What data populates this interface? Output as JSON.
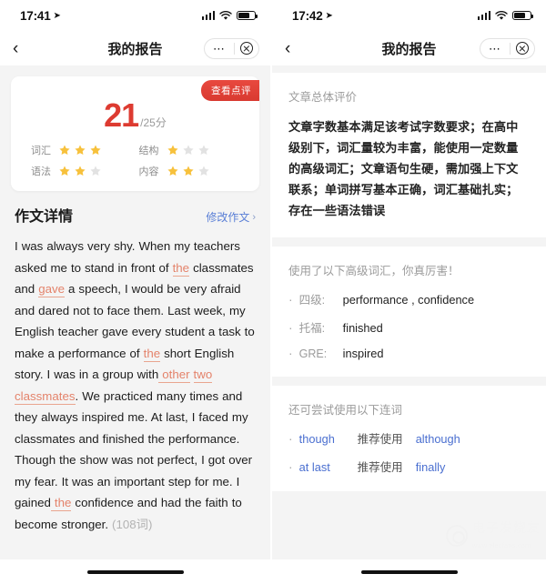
{
  "left": {
    "status": {
      "time": "17:41",
      "location_icon": "location-arrow-icon"
    },
    "nav": {
      "back_icon": "chevron-left-icon",
      "title": "我的报告",
      "more_icon": "ellipsis-icon",
      "close_icon": "close-circle-icon"
    },
    "score_card": {
      "badge": "查看点评",
      "score": "21",
      "denominator": "/25分",
      "ratings": [
        {
          "label": "词汇",
          "filled": 3,
          "total": 3
        },
        {
          "label": "结构",
          "filled": 1,
          "total": 3
        },
        {
          "label": "语法",
          "filled": 2,
          "total": 3
        },
        {
          "label": "内容",
          "filled": 2,
          "total": 3
        }
      ]
    },
    "essay": {
      "title": "作文详情",
      "edit_link": "修改作文",
      "chevron": "›",
      "segments": [
        {
          "t": "I was always very shy. When my teachers asked me to stand in front of ",
          "k": "n"
        },
        {
          "t": "the",
          "k": "c"
        },
        {
          "t": " classmates and ",
          "k": "n"
        },
        {
          "t": "gave",
          "k": "c"
        },
        {
          "t": " a speech, I would be very afraid and dared not to face them. Last week, my English teacher gave every student a task to make a performance of ",
          "k": "n"
        },
        {
          "t": "the",
          "k": "c"
        },
        {
          "t": " short English story. I was in a group with",
          "k": "n"
        },
        {
          "t": " other",
          "k": "c"
        },
        {
          "t": " ",
          "k": "n"
        },
        {
          "t": "two classmates",
          "k": "c"
        },
        {
          "t": ". We practiced many times and they always inspired me. At last, I faced my classmates and finished the performance. Though the show was not perfect, I got over my fear. It was an important step for me. I gained",
          "k": "n"
        },
        {
          "t": " the",
          "k": "c"
        },
        {
          "t": " confidence and had the faith to become stronger. ",
          "k": "n"
        },
        {
          "t": "(108词)",
          "k": "w"
        }
      ]
    }
  },
  "right": {
    "status": {
      "time": "17:42",
      "location_icon": "location-arrow-icon"
    },
    "nav": {
      "back_icon": "chevron-left-icon",
      "title": "我的报告",
      "more_icon": "ellipsis-icon",
      "close_icon": "close-circle-icon"
    },
    "overall": {
      "title": "文章总体评价",
      "body": "文章字数基本满足该考试字数要求；在高中级别下，词汇量较为丰富，能使用一定数量的高级词汇；文章语句生硬，需加强上下文联系；单词拼写基本正确，词汇基础扎实；存在一些语法错误"
    },
    "vocab": {
      "title": "使用了以下高级词汇，你真厉害！",
      "items": [
        {
          "level": "四级:",
          "words": "performance , confidence"
        },
        {
          "level": "托福:",
          "words": "finished"
        },
        {
          "level": "GRE:",
          "words": "inspired"
        }
      ]
    },
    "conjunctions": {
      "title": "还可尝试使用以下连词",
      "items": [
        {
          "from": "though",
          "mid": "推荐使用",
          "to": "although"
        },
        {
          "from": "at last",
          "mid": "推荐使用",
          "to": "finally"
        }
      ]
    },
    "watermark": {
      "main": "电子发烧友",
      "sub": "www.elecfans.com"
    }
  },
  "colors": {
    "score_red": "#dd3b31",
    "badge_red": "#e8493f",
    "star_on": "#f7c13c",
    "star_off": "#e2e2e2",
    "link_blue": "#5a7fd6",
    "correction": "#e4836b"
  }
}
